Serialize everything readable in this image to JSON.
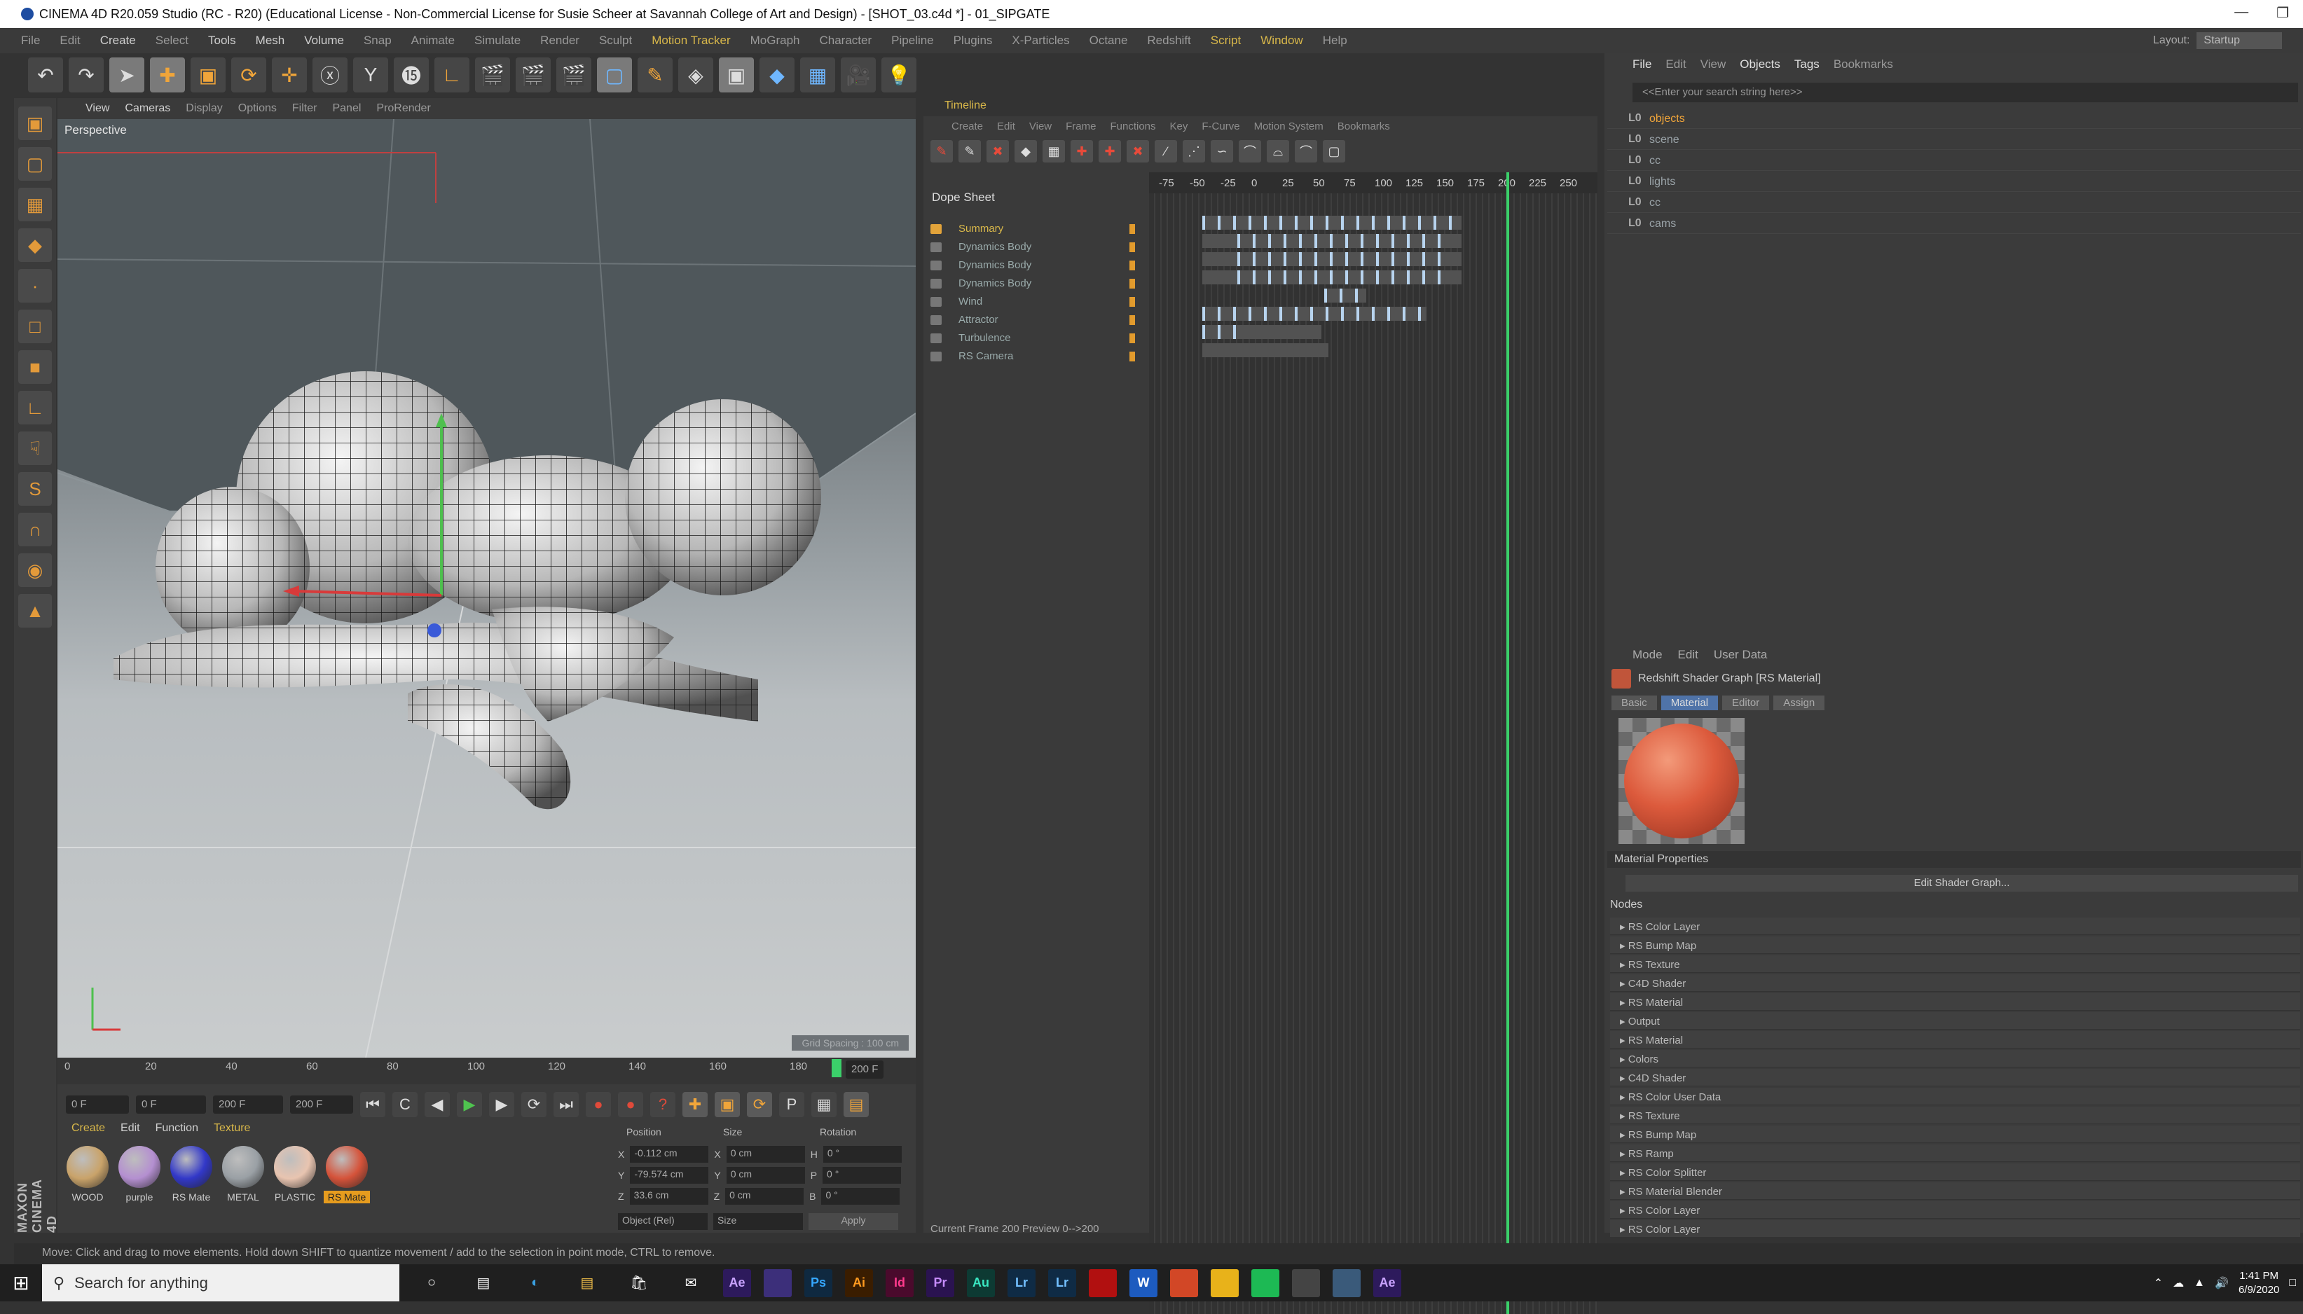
{
  "window": {
    "title": "CINEMA 4D R20.059 Studio (RC - R20) (Educational License - Non-Commercial License for Susie Scheer at Savannah College of Art and Design) - [SHOT_03.c4d *] - 01_SIPGATE",
    "layout_label": "Layout:",
    "layout_value": "Startup"
  },
  "menu": [
    "File",
    "Edit",
    "Create",
    "Select",
    "Tools",
    "Mesh",
    "Volume",
    "Snap",
    "Animate",
    "Simulate",
    "Render",
    "Sculpt",
    "Motion Tracker",
    "MoGraph",
    "Character",
    "Pipeline",
    "Plugins",
    "X-Particles",
    "Octane",
    "Redshift",
    "Script",
    "Window",
    "Help"
  ],
  "viewport": {
    "menu": [
      "View",
      "Cameras",
      "Display",
      "Options",
      "Filter",
      "Panel",
      "ProRender"
    ],
    "label": "Perspective",
    "grid_spacing": "Grid Spacing : 100 cm"
  },
  "timeline": {
    "ruler": [
      "0",
      "20",
      "40",
      "60",
      "80",
      "100",
      "120",
      "140",
      "160",
      "180"
    ],
    "end_frame_label": "200 F",
    "start_field": "0 F",
    "range_start": "0 F",
    "range_end": "200 F",
    "max_field": "200 F"
  },
  "materials": {
    "menu": [
      "Create",
      "Edit",
      "Function",
      "Texture"
    ],
    "items": [
      {
        "label": "WOOD",
        "color": "#c9a36a"
      },
      {
        "label": "purple",
        "color": "#b48fd0"
      },
      {
        "label": "RS Mate",
        "color": "#3238c8"
      },
      {
        "label": "METAL",
        "color": "#9aa0a5"
      },
      {
        "label": "PLASTIC",
        "color": "#e8c4b0"
      },
      {
        "label": "RS Mate",
        "color": "#d5533a"
      }
    ]
  },
  "coords": {
    "headers": [
      "Position",
      "Size",
      "Rotation"
    ],
    "rows": [
      {
        "a": "X",
        "pos": "-0.112 cm",
        "b": "X",
        "size": "0 cm",
        "c": "H",
        "rot": "0 °"
      },
      {
        "a": "Y",
        "pos": "-79.574 cm",
        "b": "Y",
        "size": "0 cm",
        "c": "P",
        "rot": "0 °"
      },
      {
        "a": "Z",
        "pos": "33.6 cm",
        "b": "Z",
        "size": "0 cm",
        "c": "B",
        "rot": "0 °"
      }
    ],
    "mode": "Object (Rel)",
    "size_mode": "Size",
    "apply": "Apply"
  },
  "branding": "MAXON CINEMA 4D",
  "timeline_panel": {
    "title": "Timeline",
    "menu": [
      "Create",
      "Edit",
      "View",
      "Frame",
      "Functions",
      "Key",
      "F-Curve",
      "Motion System",
      "Bookmarks"
    ],
    "dope_sheet": "Dope Sheet",
    "ruler": [
      "-75",
      "-50",
      "-25",
      "0",
      "25",
      "50",
      "75",
      "100",
      "125",
      "150",
      "175",
      "200",
      "225",
      "250"
    ],
    "playhead_label": "200",
    "tracks": [
      {
        "name": "Summary"
      },
      {
        "name": "Dynamics Body"
      },
      {
        "name": "Dynamics Body"
      },
      {
        "name": "Dynamics Body"
      },
      {
        "name": "Wind"
      },
      {
        "name": "Attractor"
      },
      {
        "name": "Turbulence"
      },
      {
        "name": "RS Camera"
      }
    ],
    "current_frame": "Current Frame  200  Preview  0-->200"
  },
  "objects": {
    "menu": [
      "File",
      "Edit",
      "View",
      "Objects",
      "Tags",
      "Bookmarks"
    ],
    "search_placeholder": "<<Enter your search string here>>",
    "items": [
      {
        "name": "objects",
        "selected": true
      },
      {
        "name": "scene",
        "selected": false
      },
      {
        "name": "cc",
        "selected": false
      },
      {
        "name": "lights",
        "selected": false
      },
      {
        "name": "cc",
        "selected": false
      },
      {
        "name": "cams",
        "selected": false
      }
    ]
  },
  "attributes": {
    "menu": [
      "Mode",
      "Edit",
      "User Data"
    ],
    "title": "Redshift Shader Graph [RS Material]",
    "tabs": [
      "Basic",
      "Material",
      "Editor",
      "Assign"
    ],
    "active_tab": "Material",
    "properties_label": "Material Properties",
    "edit_button": "Edit Shader Graph...",
    "nodes_label": "Nodes",
    "nodes": [
      "RS Color Layer",
      "RS Bump Map",
      "RS Texture",
      "C4D Shader",
      "RS Material",
      "Output",
      "RS Material",
      "Colors",
      "C4D Shader",
      "RS Color User Data",
      "RS Texture",
      "RS Bump Map",
      "RS Ramp",
      "RS Color Splitter",
      "RS Material Blender",
      "RS Color Layer",
      "RS Color Layer"
    ]
  },
  "status": "Move: Click and drag to move elements. Hold down SHIFT to quantize movement / add to the selection in point mode, CTRL to remove.",
  "taskbar": {
    "search": "Search for anything",
    "apps": [
      {
        "label": "Ae",
        "color": "#2d1a5c",
        "fg": "#c9a3ff"
      },
      {
        "label": "",
        "color": "#3c2f7a",
        "fg": "#fff"
      },
      {
        "label": "Ps",
        "color": "#0f2940",
        "fg": "#35a7ff"
      },
      {
        "label": "Ai",
        "color": "#3a1d00",
        "fg": "#ff9a1f"
      },
      {
        "label": "Id",
        "color": "#4a0a2c",
        "fg": "#ff3a8c"
      },
      {
        "label": "Pr",
        "color": "#2a1350",
        "fg": "#c68cff"
      },
      {
        "label": "Au",
        "color": "#0d3a33",
        "fg": "#39e6c1"
      },
      {
        "label": "Lr",
        "color": "#0f2b45",
        "fg": "#73c0ff"
      },
      {
        "label": "Lr",
        "color": "#0f2b45",
        "fg": "#73c0ff"
      },
      {
        "label": "",
        "color": "#b11010",
        "fg": "#fff"
      },
      {
        "label": "W",
        "color": "#1d5bbf",
        "fg": "#fff"
      },
      {
        "label": "",
        "color": "#d24726",
        "fg": "#fff"
      },
      {
        "label": "",
        "color": "#e8b21a",
        "fg": "#fff"
      },
      {
        "label": "",
        "color": "#1db954",
        "fg": "#000"
      },
      {
        "label": "",
        "color": "#444",
        "fg": "#fff"
      },
      {
        "label": "",
        "color": "#3a5a7a",
        "fg": "#fff"
      },
      {
        "label": "Ae",
        "color": "#2d1a5c",
        "fg": "#c9a3ff"
      }
    ],
    "time": "1:41 PM",
    "date": "6/9/2020"
  }
}
